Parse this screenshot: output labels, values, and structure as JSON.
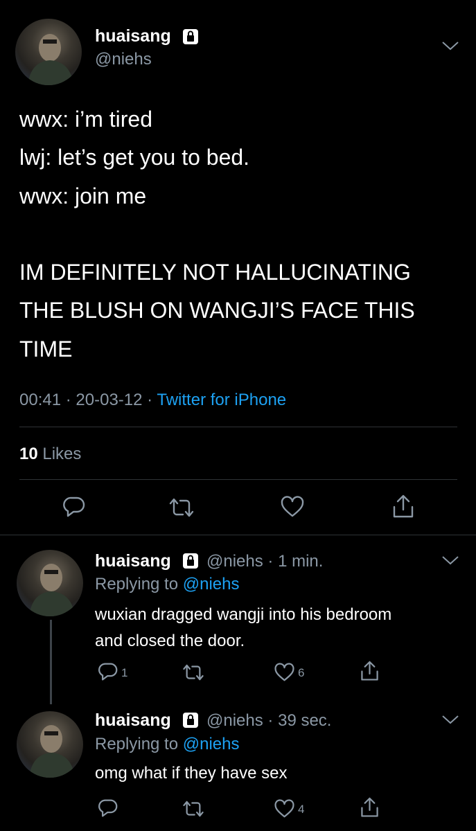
{
  "main_tweet": {
    "display_name": "huaisang",
    "handle": "@niehs",
    "lines": [
      "wwx: i’m tired",
      "lwj: let’s get you to bed.",
      "wwx: join me",
      "",
      "IM DEFINITELY NOT HALLUCINATING",
      "THE BLUSH ON WANGJI’S FACE THIS",
      "TIME"
    ],
    "time": "00:41",
    "date": "20-03-12",
    "sep": "·",
    "source": "Twitter for iPhone",
    "likes_count": "10",
    "likes_label": "Likes"
  },
  "replies": [
    {
      "display_name": "huaisang",
      "handle": "@niehs",
      "sep": "·",
      "age": "1 min.",
      "replying_prefix": "Replying to",
      "replying_handle": "@niehs",
      "text_lines": [
        "wuxian dragged wangji into his bedroom",
        "and closed the door."
      ],
      "reply_count": "1",
      "like_count": "6"
    },
    {
      "display_name": "huaisang",
      "handle": "@niehs",
      "sep": "·",
      "age": "39 sec.",
      "replying_prefix": "Replying to",
      "replying_handle": "@niehs",
      "text_lines": [
        "omg what if they have sex"
      ],
      "reply_count": "",
      "like_count": "4"
    }
  ],
  "icons": {
    "lock": "lock-icon",
    "menu": "chevron-down-icon",
    "reply": "reply-icon",
    "retweet": "retweet-icon",
    "like": "heart-icon",
    "share": "share-icon"
  },
  "colors": {
    "background": "#000000",
    "text": "#ffffff",
    "secondary": "#8b98a5",
    "accent": "#1da1f2",
    "divider": "#2f3336"
  }
}
